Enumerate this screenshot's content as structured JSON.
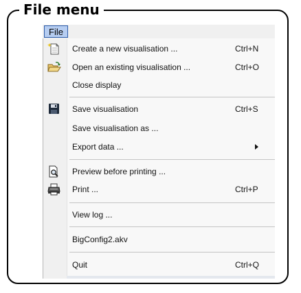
{
  "frame": {
    "title": "File menu"
  },
  "menubar": {
    "file": "File"
  },
  "menu": {
    "new_vis": {
      "label": "Create a new visualisation ...",
      "shortcut": "Ctrl+N",
      "icon": "new-document-icon"
    },
    "open_vis": {
      "label": "Open an existing visualisation ...",
      "shortcut": "Ctrl+O",
      "icon": "open-folder-icon"
    },
    "close_display": {
      "label": "Close display"
    },
    "save_vis": {
      "label": "Save visualisation",
      "shortcut": "Ctrl+S",
      "icon": "floppy-disk-icon"
    },
    "save_vis_as": {
      "label": "Save visualisation as ..."
    },
    "export_data": {
      "label": "Export data ...",
      "submenu": true
    },
    "print_preview": {
      "label": "Preview before printing ...",
      "icon": "print-preview-icon"
    },
    "print": {
      "label": "Print ...",
      "shortcut": "Ctrl+P",
      "icon": "printer-icon"
    },
    "view_log": {
      "label": "View log ..."
    },
    "recent_file": {
      "label": "BigConfig2.akv"
    },
    "quit": {
      "label": "Quit",
      "shortcut": "Ctrl+Q"
    }
  },
  "colors": {
    "menu_highlight": "#b6cdf1",
    "menu_highlight_border": "#2a5aa8",
    "frame": "#000000"
  }
}
